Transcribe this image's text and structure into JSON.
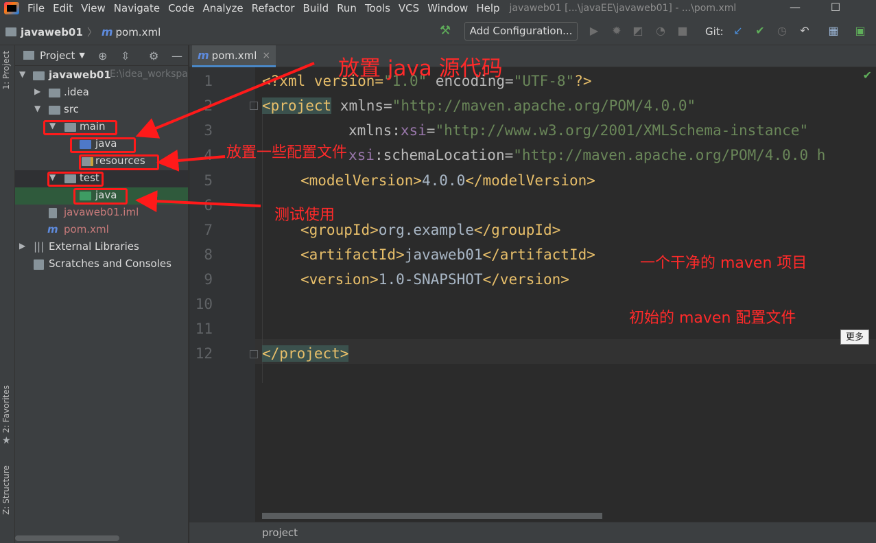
{
  "menubar": {
    "items": [
      "File",
      "Edit",
      "View",
      "Navigate",
      "Code",
      "Analyze",
      "Refactor",
      "Build",
      "Run",
      "Tools",
      "VCS",
      "Window",
      "Help"
    ],
    "window_title": "javaweb01 [...\\javaEE\\javaweb01] - ...\\pom.xml",
    "minimize": "—",
    "maximize": "☐"
  },
  "navbar": {
    "project_name": "javaweb01",
    "file_name": "pom.xml",
    "add_configuration": "Add Configuration...",
    "git_label": "Git:"
  },
  "left_strip": {
    "project_tab": "1: Project",
    "favorites_tab": "2: Favorites",
    "structure_tab": "Z: Structure"
  },
  "project_panel": {
    "header_label": "Project",
    "tree": [
      {
        "label": "javaweb01",
        "path_hint": "E:\\idea_workspa"
      },
      {
        "label": ".idea"
      },
      {
        "label": "src"
      },
      {
        "label": "main"
      },
      {
        "label": "java"
      },
      {
        "label": "resources"
      },
      {
        "label": "test"
      },
      {
        "label": "java"
      },
      {
        "label": "javaweb01.iml"
      },
      {
        "label": "pom.xml"
      },
      {
        "label": "External Libraries"
      },
      {
        "label": "Scratches and Consoles"
      }
    ]
  },
  "editor": {
    "tab_label": "pom.xml",
    "tab_close": "×",
    "line_numbers": [
      "1",
      "2",
      "3",
      "4",
      "5",
      "6",
      "7",
      "8",
      "9",
      "10",
      "11",
      "12"
    ],
    "code": {
      "l1_a": "<?xml version=",
      "l1_b": "\"1.0\"",
      "l1_c": " encoding=",
      "l1_d": "\"UTF-8\"",
      "l1_e": "?>",
      "l2_tag": "<project",
      "l2_attr": " xmlns=",
      "l2_val": "\"http://maven.apache.org/POM/4.0.0\"",
      "l3_attr": "xmlns:",
      "l3_ns": "xsi",
      "l3_eq": "=",
      "l3_val": "\"http://www.w3.org/2001/XMLSchema-instance\"",
      "l4_ns": "xsi",
      "l4_attr": ":schemaLocation=",
      "l4_val": "\"http://maven.apache.org/POM/4.0.0 h",
      "l5_open": "<modelVersion>",
      "l5_text": "4.0.0",
      "l5_close": "</modelVersion>",
      "l7_open": "<groupId>",
      "l7_text": "org.example",
      "l7_close": "</groupId>",
      "l8_open": "<artifactId>",
      "l8_text": "javaweb01",
      "l8_close": "</artifactId>",
      "l9_open": "<version>",
      "l9_text": "1.0-SNAPSHOT",
      "l9_close": "</version>",
      "l12_close": "</project>"
    },
    "more_button": "更多",
    "footer_breadcrumb": "project"
  },
  "annotations": {
    "java_source": "放置 java 源代码",
    "config_files": "放置一些配置文件",
    "test_use": "测试使用",
    "clean_project": "一个干净的 maven 项目",
    "initial_config": "初始的 maven 配置文件",
    "color": "#ff1a1a"
  }
}
